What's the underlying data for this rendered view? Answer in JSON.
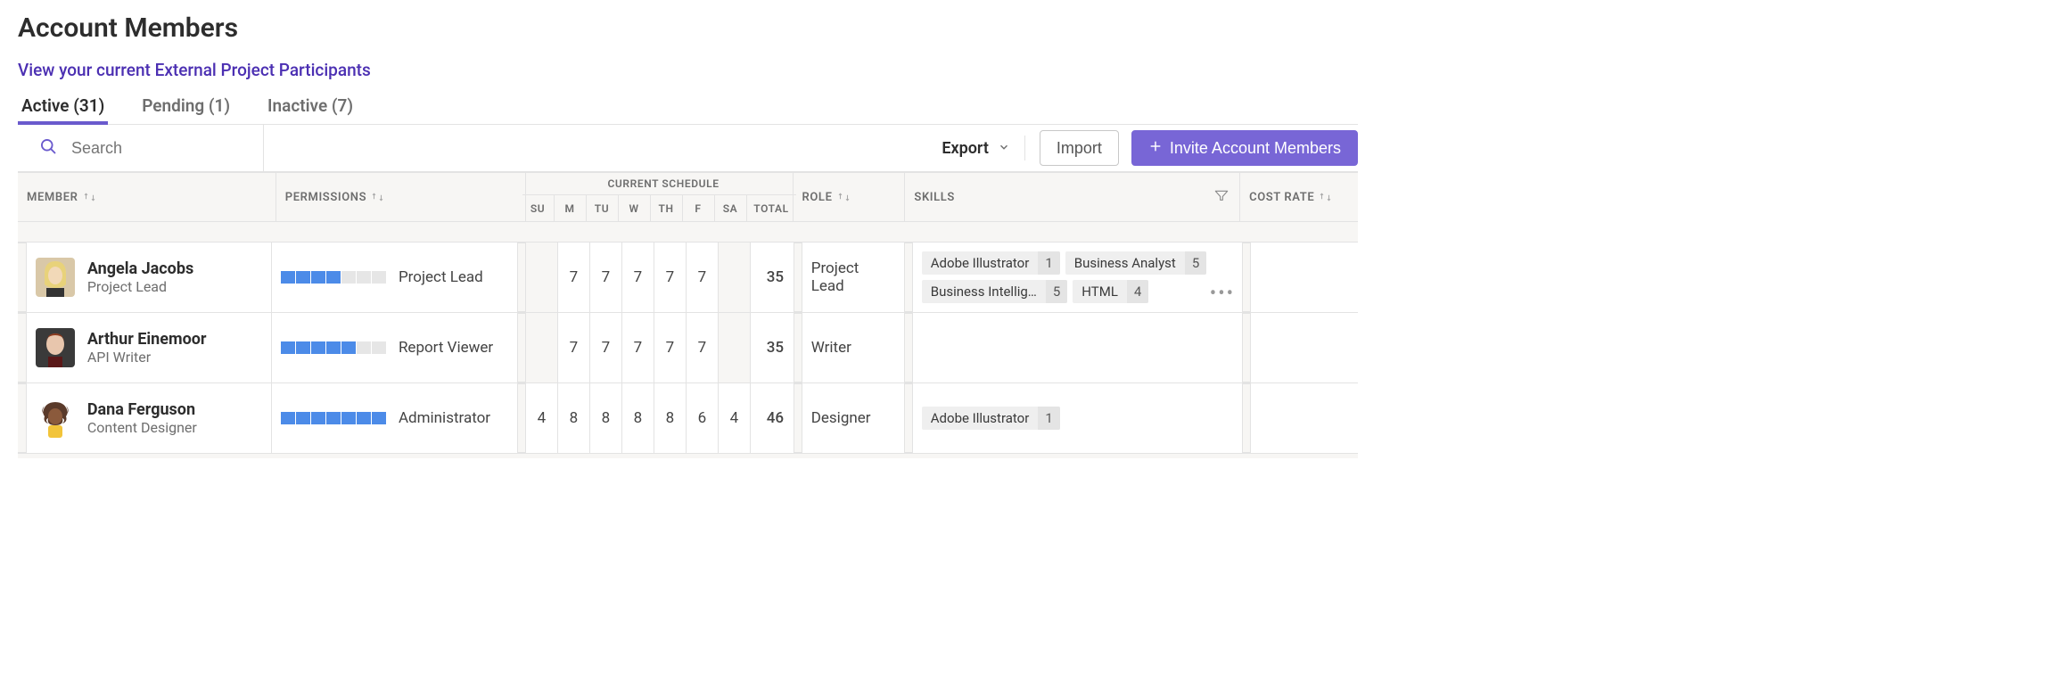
{
  "page_title": "Account Members",
  "external_link": "View your current External Project Participants",
  "tabs": [
    {
      "id": "active",
      "label": "Active (31)",
      "active": true
    },
    {
      "id": "pending",
      "label": "Pending (1)",
      "active": false
    },
    {
      "id": "inactive",
      "label": "Inactive (7)",
      "active": false
    }
  ],
  "toolbar": {
    "search_placeholder": "Search",
    "export_label": "Export",
    "import_label": "Import",
    "invite_label": "Invite Account Members"
  },
  "columns": {
    "member": "MEMBER",
    "permissions": "PERMISSIONS",
    "schedule": "CURRENT SCHEDULE",
    "days": {
      "su": "SU",
      "m": "M",
      "tu": "TU",
      "w": "W",
      "th": "TH",
      "f": "F",
      "sa": "SA",
      "total": "TOTAL"
    },
    "role": "ROLE",
    "skills": "SKILLS",
    "cost": "COST RATE"
  },
  "members": [
    {
      "name": "Angela Jacobs",
      "subtitle": "Project Lead",
      "avatar": "angela",
      "perm_level": 4,
      "perm_label": "Project Lead",
      "schedule": {
        "su": "",
        "m": "7",
        "tu": "7",
        "w": "7",
        "th": "7",
        "f": "7",
        "sa": "",
        "total": "35"
      },
      "role": "Project Lead",
      "skills": [
        {
          "label": "Adobe Illustrator",
          "num": "1"
        },
        {
          "label": "Business Analyst",
          "num": "5"
        },
        {
          "label": "Business Intellig…",
          "num": "5"
        },
        {
          "label": "HTML",
          "num": "4"
        }
      ],
      "more": true
    },
    {
      "name": "Arthur Einemoor",
      "subtitle": "API Writer",
      "avatar": "arthur",
      "perm_level": 5,
      "perm_label": "Report Viewer",
      "schedule": {
        "su": "",
        "m": "7",
        "tu": "7",
        "w": "7",
        "th": "7",
        "f": "7",
        "sa": "",
        "total": "35"
      },
      "role": "Writer",
      "skills": [],
      "more": false
    },
    {
      "name": "Dana Ferguson",
      "subtitle": "Content Designer",
      "avatar": "dana",
      "perm_level": 7,
      "perm_label": "Administrator",
      "schedule": {
        "su": "4",
        "m": "8",
        "tu": "8",
        "w": "8",
        "th": "8",
        "f": "6",
        "sa": "4",
        "total": "46"
      },
      "role": "Designer",
      "skills": [
        {
          "label": "Adobe Illustrator",
          "num": "1"
        }
      ],
      "more": false
    }
  ]
}
